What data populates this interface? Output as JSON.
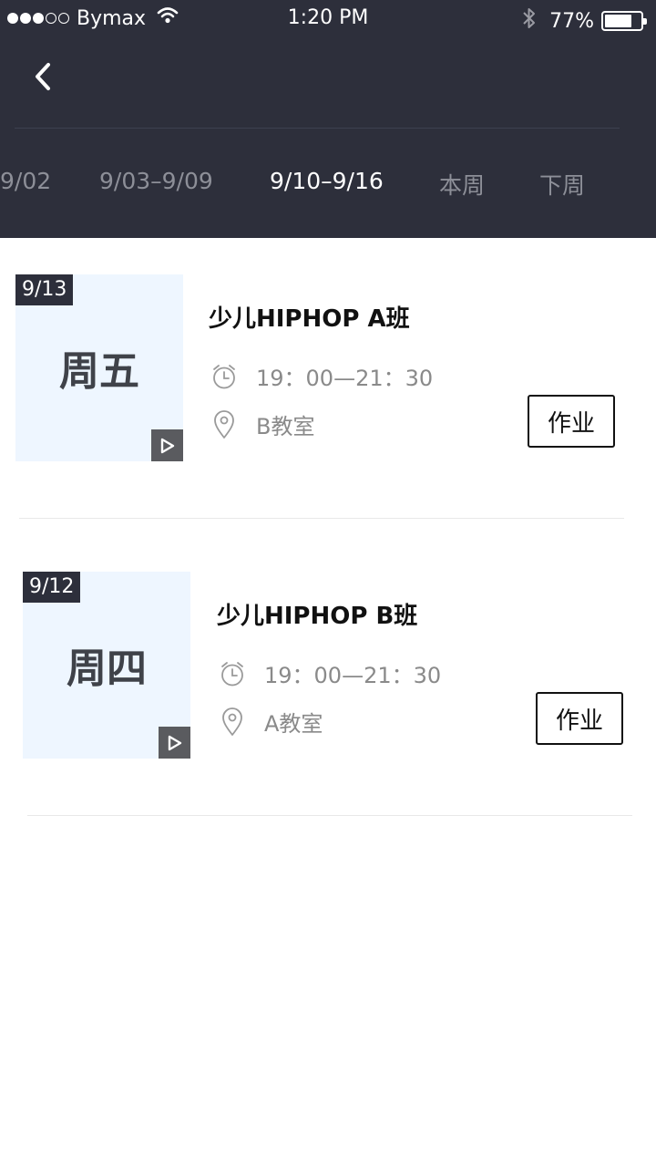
{
  "status_bar": {
    "carrier": "Bymax",
    "time": "1:20 PM",
    "battery": "77%",
    "battery_level": 0.77,
    "signal_bars": 3,
    "signal_total": 5
  },
  "nav": {
    "back_icon": "chevron-left-icon"
  },
  "week_tabs": [
    {
      "label": "9/02"
    },
    {
      "label": "9/03–9/09"
    },
    {
      "label": "9/10–9/16",
      "active": true
    },
    {
      "label": "本周"
    },
    {
      "label": "下周"
    }
  ],
  "lessons": [
    {
      "date": "9/13",
      "weekday": "周五",
      "title": "少儿HIPHOP A班",
      "time": "19：00—21：30",
      "room": "B教室",
      "homework_label": "作业"
    },
    {
      "date": "9/12",
      "weekday": "周四",
      "title": "少儿HIPHOP B班",
      "time": "19：00—21：30",
      "room": "A教室",
      "homework_label": "作业"
    }
  ],
  "colors": {
    "header_bg": "#2d2f3b",
    "thumb_bg": "#eef6ff",
    "tab_inactive": "#8d8f98",
    "tab_active": "#ffffff"
  }
}
